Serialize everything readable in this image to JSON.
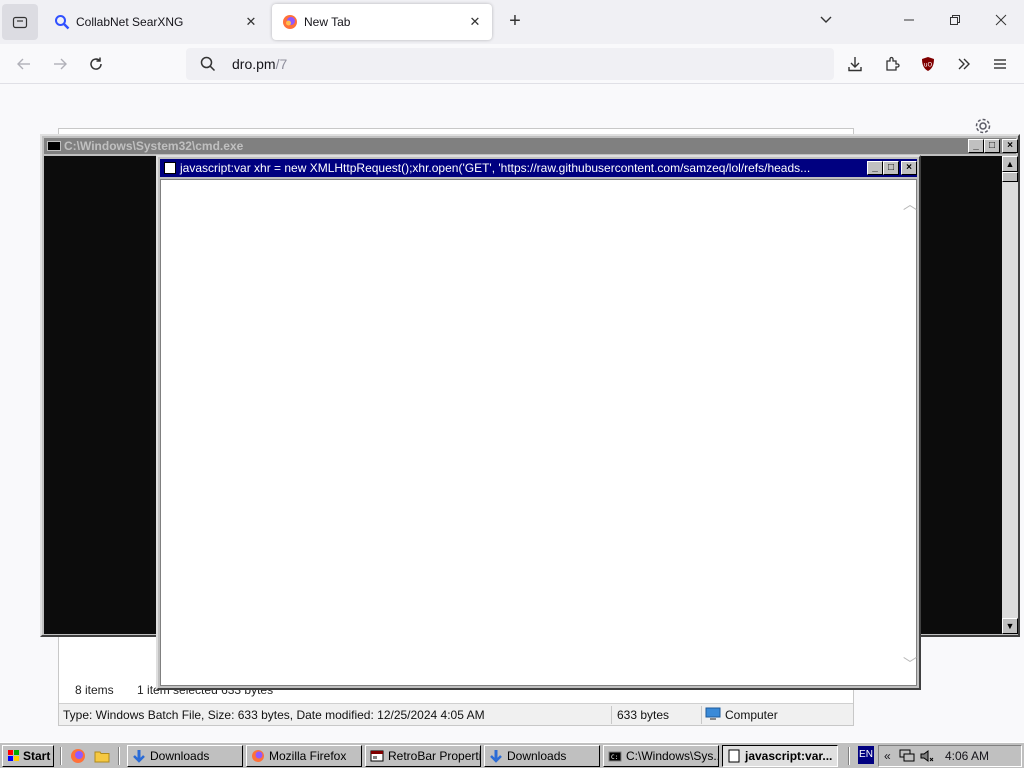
{
  "browser": {
    "tabs": [
      {
        "title": "CollabNet SearXNG",
        "icon": "search-icon"
      },
      {
        "title": "New Tab",
        "icon": "firefox-icon"
      }
    ],
    "url_domain": "dro.pm",
    "url_path": "/7"
  },
  "explorer": {
    "items_count": "8 items",
    "selected": "1 item selected  633 bytes",
    "status_type": "Type: Windows Batch File, Size: 633 bytes, Date modified: 12/25/2024 4:05 AM",
    "status_size": "633 bytes",
    "status_location": "Computer"
  },
  "cmd": {
    "title": "C:\\Windows\\System32\\cmd.exe"
  },
  "jswin": {
    "title": "javascript:var xhr = new XMLHttpRequest();xhr.open('GET', 'https://raw.githubusercontent.com/samzeq/lol/refs/heads..."
  },
  "taskbar": {
    "start_label": "Start",
    "buttons": [
      {
        "label": "Downloads",
        "icon": "download-arrow-icon"
      },
      {
        "label": "Mozilla Firefox",
        "icon": "firefox-icon"
      },
      {
        "label": "RetroBar Properti...",
        "icon": "properties-icon"
      },
      {
        "label": "Downloads",
        "icon": "download-arrow-icon"
      },
      {
        "label": "C:\\Windows\\Sys...",
        "icon": "cmd-icon"
      },
      {
        "label": "javascript:var...",
        "icon": "page-icon"
      }
    ],
    "language": "EN",
    "chevron": "«",
    "clock": "4:06 AM"
  }
}
